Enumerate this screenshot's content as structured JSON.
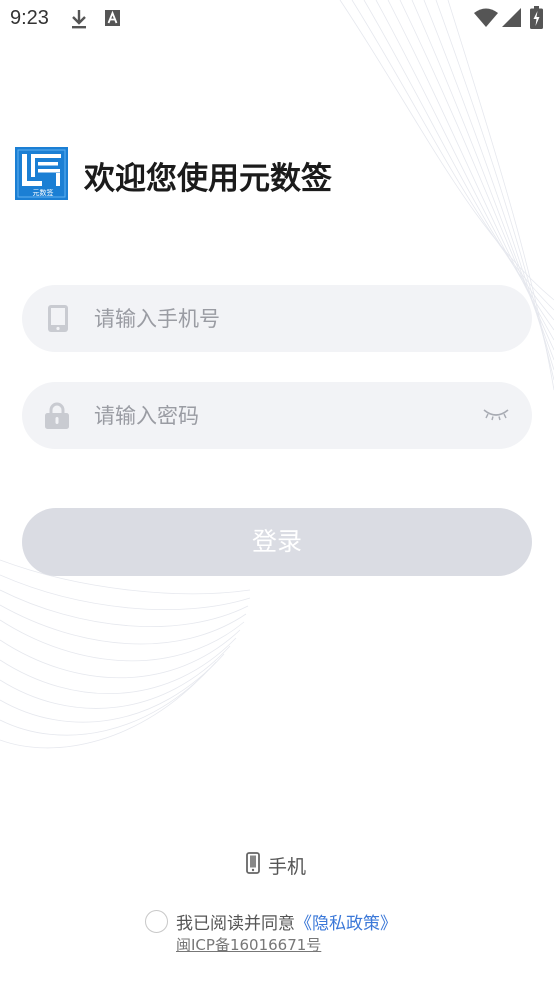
{
  "status_bar": {
    "time": "9:23",
    "icons": [
      "download-icon",
      "a-notification-icon",
      "wifi-icon",
      "signal-icon",
      "battery-charging-icon"
    ]
  },
  "header": {
    "logo_text": "元数签",
    "welcome": "欢迎您使用元数签"
  },
  "form": {
    "phone_placeholder": "请输入手机号",
    "phone_value": "",
    "password_placeholder": "请输入密码",
    "password_value": "",
    "login_label": "登录"
  },
  "login_mode": {
    "label": "手机"
  },
  "agreement": {
    "prefix": "我已阅读并同意",
    "link": "《隐私政策》",
    "checked": false,
    "icp": "闽ICP备16016671号"
  },
  "colors": {
    "accent_link": "#3b78d8",
    "field_bg": "#f2f3f6",
    "button_disabled": "#dadce3",
    "logo_blue": "#1b7fd4"
  }
}
